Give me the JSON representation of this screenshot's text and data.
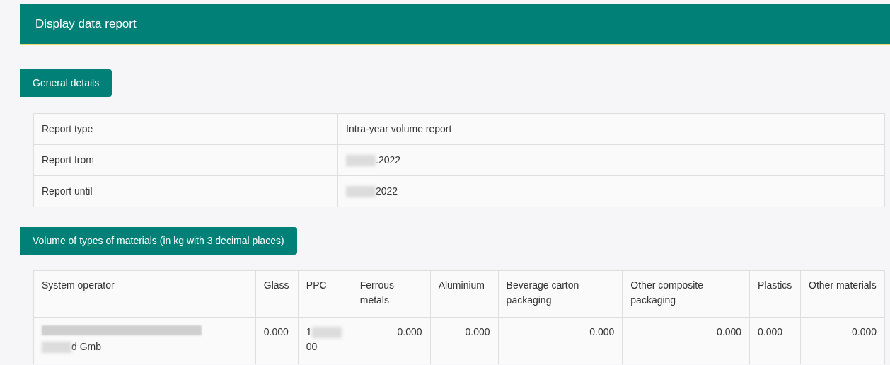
{
  "header": {
    "title": "Display data report"
  },
  "general": {
    "heading": "General details",
    "rows": [
      {
        "label": "Report type",
        "value": [
          {
            "kind": "text",
            "text": "Intra-year volume report"
          }
        ]
      },
      {
        "label": "Report from",
        "value": [
          {
            "kind": "blur"
          },
          {
            "kind": "text",
            "text": ".2022"
          }
        ]
      },
      {
        "label": "Report until",
        "value": [
          {
            "kind": "blur"
          },
          {
            "kind": "text",
            "text": "2022"
          }
        ]
      }
    ]
  },
  "volumes": {
    "heading": "Volume of types of materials (in kg with 3 decimal places)",
    "columns": [
      "System operator",
      "Glass",
      "PPC",
      "Ferrous metals",
      "Aluminium",
      "Beverage carton packaging",
      "Other composite packaging",
      "Plastics",
      "Other materials"
    ],
    "rows": [
      [
        [
          {
            "kind": "blur-long"
          },
          {
            "kind": "break"
          },
          {
            "kind": "blur"
          },
          {
            "kind": "text",
            "text": "d Gmb"
          }
        ],
        [
          {
            "kind": "text",
            "text": "0.000"
          }
        ],
        [
          {
            "kind": "text",
            "text": "1"
          },
          {
            "kind": "blur"
          },
          {
            "kind": "text",
            "text": "00"
          }
        ],
        [
          {
            "kind": "text",
            "text": "0.000"
          }
        ],
        [
          {
            "kind": "text",
            "text": "0.000"
          }
        ],
        [
          {
            "kind": "text",
            "text": "0.000"
          }
        ],
        [
          {
            "kind": "text",
            "text": "0.000"
          }
        ],
        [
          {
            "kind": "text",
            "text": "0.000"
          }
        ],
        [
          {
            "kind": "text",
            "text": "0.000"
          }
        ]
      ]
    ]
  }
}
